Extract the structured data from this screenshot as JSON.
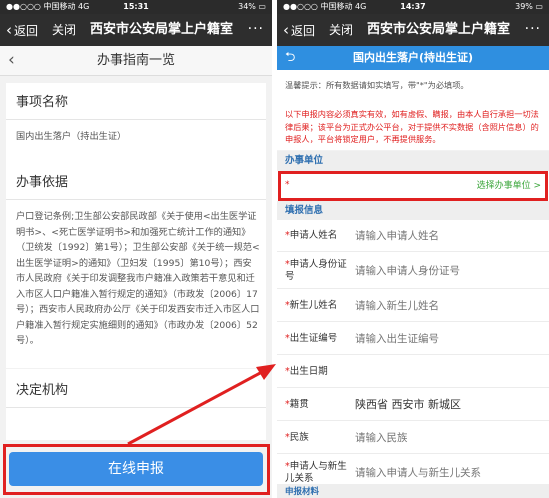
{
  "left": {
    "status": {
      "carrier": "●●○○○ 中国移动  4G",
      "time": "15:31",
      "battery": "34% ▭"
    },
    "wechat": {
      "back": "返回",
      "close": "关闭",
      "title": "西安市公安局掌上户籍室",
      "more": "···"
    },
    "header": {
      "title": "办事指南一览"
    },
    "item_section": {
      "title": "事项名称",
      "value": "国内出生落户（持出生证）"
    },
    "basis_section": {
      "title": "办事依据",
      "text": "户口登记条例;卫生部公安部民政部《关于使用<出生医学证明书>、<死亡医学证明书>和加强死亡统计工作的通知》（卫统发〔1992〕第1号）；卫生部公安部《关于统一规范<出生医学证明>的通知》（卫妇发〔1995〕第10号）；西安市人民政府《关于印发调整我市户籍准入政策若干意见和迁入市区人口户籍准入暂行规定的通知》（市政发〔2006〕17号）；西安市人民政府办公厅《关于印发西安市迁入市区人口户籍准入暂行规定实施细则的通知》（市政办发〔2006〕52号）。"
    },
    "decision_section": {
      "title": "决定机构"
    },
    "submit_label": "在线申报"
  },
  "right": {
    "status": {
      "carrier": "●●○○○ 中国移动  4G",
      "time": "14:37",
      "battery": "39% ▭"
    },
    "wechat": {
      "back": "返回",
      "close": "关闭",
      "title": "西安市公安局掌上户籍室",
      "more": "···"
    },
    "header": {
      "back_icon": "⮌",
      "title": "国内出生落户(持出生证)"
    },
    "notice": {
      "line1": "温馨提示：所有数据请如实填写，带\"*\"为必填项。",
      "line2": "以下申报内容必须真实有效，如有虚假、瞒报，由本人自行承担一切法律后果；该平台为正式办公平台，对于提供不实数据（含照片信息）的申报人，平台将锁定用户，不再提供服务。"
    },
    "org_section": {
      "title": "办事单位",
      "required_mark": "*",
      "select_link": "选择办事单位 >"
    },
    "fill_section": {
      "title": "填报信息"
    },
    "fields": [
      {
        "label": "申请人姓名",
        "placeholder": "请输入申请人姓名",
        "value": ""
      },
      {
        "label": "申请人身份证号",
        "placeholder": "请输入申请人身份证号",
        "value": ""
      },
      {
        "label": "新生儿姓名",
        "placeholder": "请输入新生儿姓名",
        "value": ""
      },
      {
        "label": "出生证编号",
        "placeholder": "请输入出生证编号",
        "value": ""
      },
      {
        "label": "出生日期",
        "placeholder": "",
        "value": ""
      },
      {
        "label": "籍贯",
        "placeholder": "",
        "value": "陕西省 西安市 新城区"
      },
      {
        "label": "民族",
        "placeholder": "请输入民族",
        "value": ""
      },
      {
        "label": "申请人与新生儿关系",
        "placeholder": "请输入申请人与新生儿关系",
        "value": ""
      }
    ],
    "materials_section": {
      "title": "申报材料"
    }
  },
  "colors": {
    "accent": "#3a8ee6",
    "highlight": "#e02020",
    "header_blue": "#2f8fe0",
    "link_green": "#3aa53a"
  }
}
